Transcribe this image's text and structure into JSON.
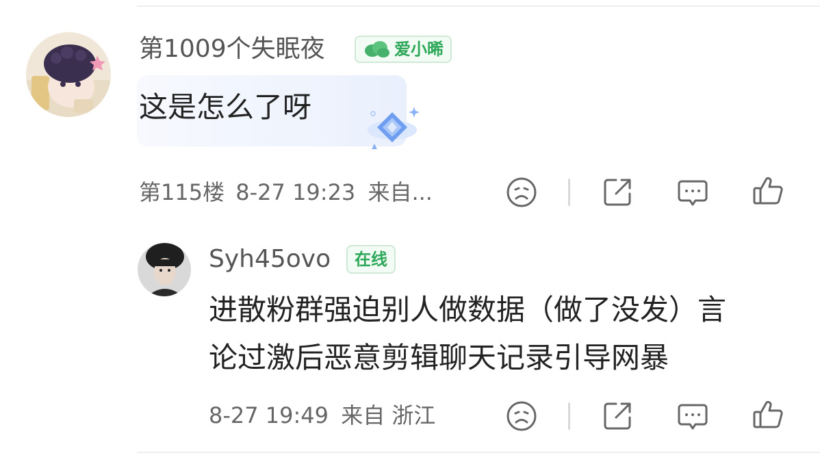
{
  "comment": {
    "username": "第1009个失眠夜",
    "badge_label": "爱小晞",
    "text": "这是怎么了呀",
    "floor": "第115楼",
    "time": "8-27 19:23",
    "location": "来自...",
    "badge_color": "#2fa85a"
  },
  "reply": {
    "username": "Syh45ovo",
    "badge_label": "在线",
    "text_line1": "进散粉群强迫别人做数据（做了没发）言",
    "text_line2": "论过激后恶意剪辑聊天记录引导网暴",
    "time": "8-27 19:49",
    "location": "来自 浙江"
  },
  "actions": [
    "sad-face-icon",
    "share-icon",
    "comment-icon",
    "like-icon"
  ]
}
